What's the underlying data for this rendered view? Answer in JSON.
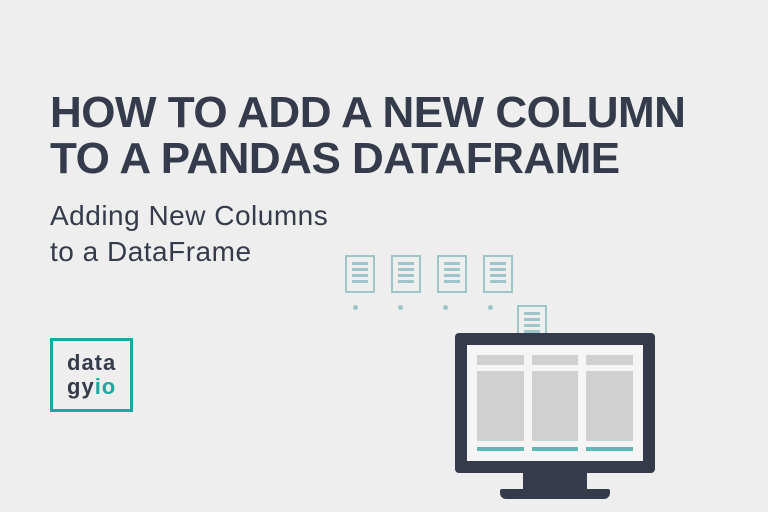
{
  "title_line1": "HOW TO ADD A NEW COLUMN",
  "title_line2": "TO A PANDAS DATAFRAME",
  "subtitle_line1": "Adding New Columns",
  "subtitle_line2": "to a DataFrame",
  "logo": {
    "line1": "data",
    "line2_a": "gy",
    "line2_b": "io"
  },
  "colors": {
    "accent": "#1ba8a0",
    "text": "#353b4a",
    "bg": "#eeeeee"
  }
}
